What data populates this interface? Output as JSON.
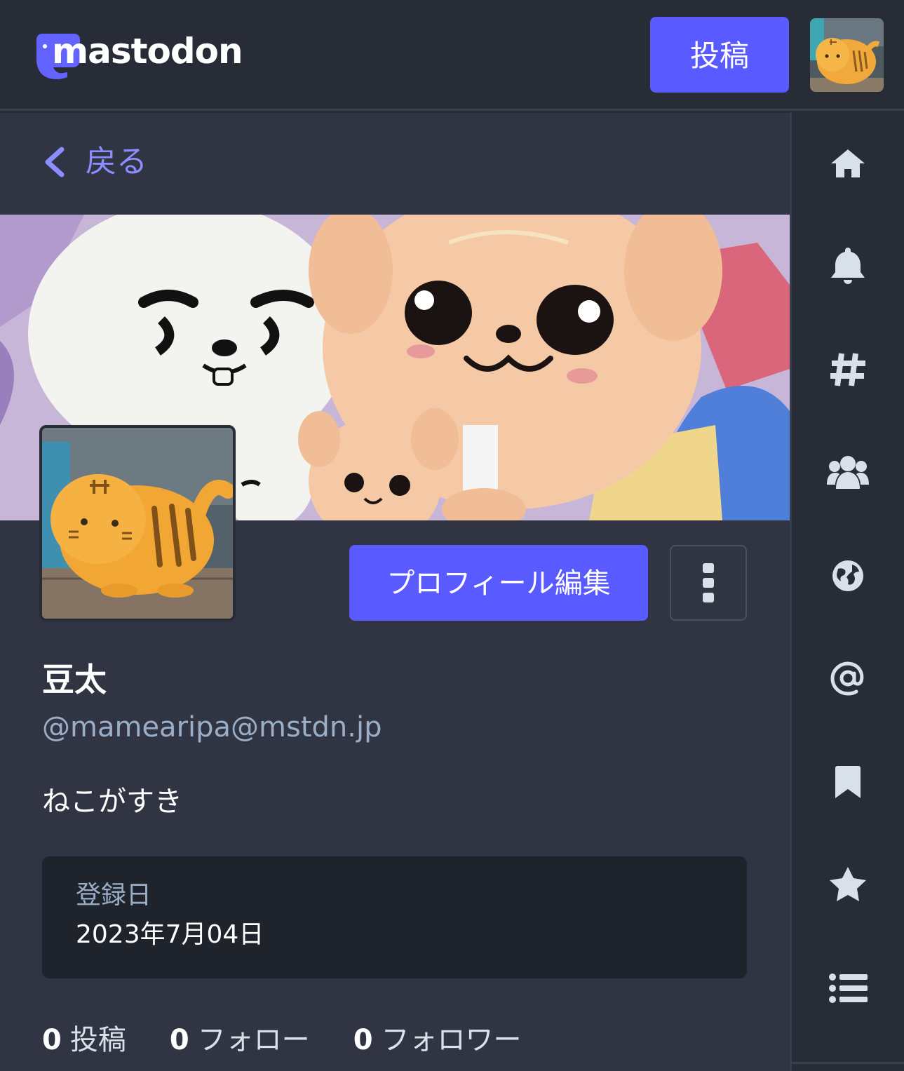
{
  "app": {
    "brand_name": "mastodon",
    "accent_color": "#595aff"
  },
  "topbar": {
    "publish_label": "投稿"
  },
  "column_header": {
    "back_label": "戻る"
  },
  "profile": {
    "edit_button_label": "プロフィール編集",
    "display_name": "豆太",
    "handle": "@mamearipa@mstdn.jp",
    "bio": "ねこがすき",
    "joined_label": "登録日",
    "joined_date": "2023年7月04日",
    "stats": [
      {
        "count": "0",
        "label": "投稿"
      },
      {
        "count": "0",
        "label": "フォロー"
      },
      {
        "count": "0",
        "label": "フォロワー"
      }
    ]
  },
  "nav": {
    "icons": [
      "home-icon",
      "bell-icon",
      "hashtag-icon",
      "users-icon",
      "globe-icon",
      "at-icon",
      "bookmark-icon",
      "star-icon",
      "list-icon"
    ]
  }
}
